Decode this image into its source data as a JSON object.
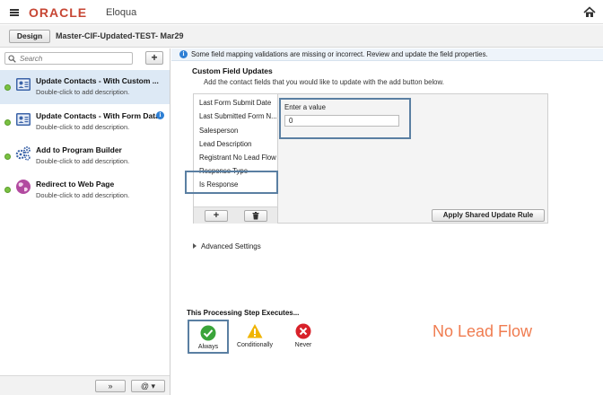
{
  "header": {
    "logo_oracle": "ORACLE",
    "logo_eloqua": "Eloqua"
  },
  "toolbar": {
    "design_tab": "Design",
    "program_title": "Master-CIF-Updated-TEST- Mar29"
  },
  "sidebar": {
    "search_placeholder": "Search",
    "add_label": "+",
    "steps": [
      {
        "title": "Update Contacts - With Custom ...",
        "desc": "Double-click to add description.",
        "icon": "contact-card-icon",
        "selected": true
      },
      {
        "title": "Update Contacts - With Form Data",
        "desc": "Double-click to add description.",
        "icon": "contact-card-icon",
        "info": "i"
      },
      {
        "title": "Add to Program Builder",
        "desc": "Double-click to add description.",
        "icon": "gears-icon"
      },
      {
        "title": "Redirect to Web Page",
        "desc": "Double-click to add description.",
        "icon": "globe-icon"
      }
    ],
    "footer": {
      "expand_label": "»",
      "at_label": "@ ▾"
    }
  },
  "main": {
    "notice": "Some field mapping validations are missing or incorrect. Review and update the field properties.",
    "section_title": "Custom Field Updates",
    "section_desc": "Add the contact fields that you would like to update with the add button below.",
    "fields": [
      "Last Form Submit Date",
      "Last Submitted Form N...",
      "Salesperson",
      "Lead Description",
      "Registrant No Lead Flow",
      "Response Type",
      "Is Response"
    ],
    "value_label": "Enter a value",
    "value": "0",
    "add_field_label": "+",
    "apply_button": "Apply Shared Update Rule",
    "advanced_settings": "Advanced Settings",
    "exec_title": "This Processing Step Executes...",
    "exec_options": [
      {
        "label": "Always",
        "icon": "check-circle-icon",
        "color": "#3aa43a"
      },
      {
        "label": "Conditionally",
        "icon": "warning-triangle-icon",
        "color": "#f0b400"
      },
      {
        "label": "Never",
        "icon": "x-circle-icon",
        "color": "#d8222a"
      }
    ],
    "annotation": "No Lead Flow"
  },
  "colors": {
    "oracle_red": "#c74634",
    "highlight": "#5a7fa2",
    "annotation": "#f07c50",
    "selected_row": "#dde9f5"
  }
}
